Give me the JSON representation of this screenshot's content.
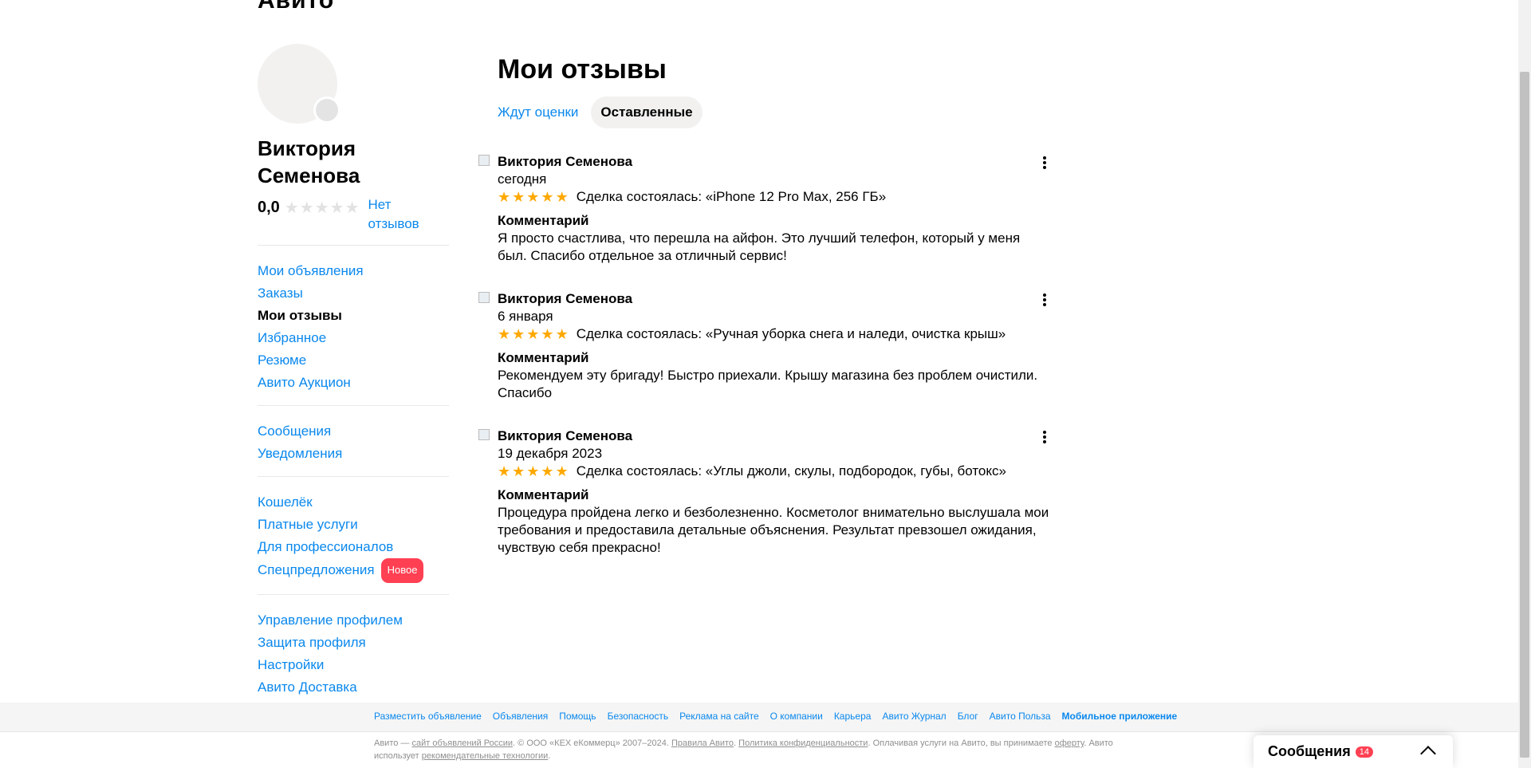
{
  "header": {
    "logo": "Авито",
    "breadcrumb": "Мои отзывы"
  },
  "profile": {
    "name": "Виктория Семенова",
    "rating": "0,0",
    "no_reviews": "Нет отзывов"
  },
  "sidebar": {
    "group1": [
      "Мои объявления",
      "Заказы",
      "Мои отзывы",
      "Избранное",
      "Резюме",
      "Авито Аукцион"
    ],
    "group2": [
      "Сообщения",
      "Уведомления"
    ],
    "group3": [
      "Кошелёк",
      "Платные услуги",
      "Для профессионалов",
      "Спецпредложения"
    ],
    "badge_new": "Новое",
    "group4": [
      "Управление профилем",
      "Защита профиля",
      "Настройки",
      "Авито Доставка"
    ]
  },
  "main": {
    "title": "Мои отзывы",
    "tabs": [
      "Ждут оценки",
      "Оставленные"
    ],
    "comment_label": "Комментарий",
    "reviews": [
      {
        "author": "Виктория Семенова",
        "date": "сегодня",
        "deal": "Сделка состоялась: «iPhone 12 Pro Max, 256 ГБ»",
        "comment": "Я просто счастлива, что перешла на айфон. Это лучший телефон, который у меня был. Спасибо отдельное за отличный сервис!"
      },
      {
        "author": "Виктория Семенова",
        "date": "6 января",
        "deal": "Сделка состоялась: «Ручная уборка снега и наледи, очистка крыш»",
        "comment": "Рекомендуем эту бригаду! Быстро приехали. Крышу магазина без проблем очистили. Спасибо"
      },
      {
        "author": "Виктория Семенова",
        "date": "19 декабря 2023",
        "deal": "Сделка состоялась: «Углы джоли, скулы, подбородок, губы, ботокс»",
        "comment": "Процедура пройдена легко и безболезненно. Косметолог внимательно выслушала мои требования и предоставила детальные объяснения. Результат превзошел ожидания, чувствую себя прекрасно!"
      }
    ]
  },
  "footer": {
    "links": [
      "Разместить объявление",
      "Объявления",
      "Помощь",
      "Безопасность",
      "Реклама на сайте",
      "О компании",
      "Карьера",
      "Авито Журнал",
      "Блог",
      "Авито Польза",
      "Мобильное приложение"
    ],
    "legal_prefix": "Авито — ",
    "legal_link1": "сайт объявлений России",
    "legal_mid1": ". © ООО «КЕХ еКоммерц» 2007–2024. ",
    "legal_link2": "Правила Авито",
    "legal_mid2": ". ",
    "legal_link3": "Политика конфиденциальности",
    "legal_mid3": ". Оплачивая услуги на Авито, вы принимаете ",
    "legal_link4": "оферту",
    "legal_mid4": ". Авито использует ",
    "legal_link5": "рекомендательные технологии",
    "legal_end": "."
  },
  "messages_widget": {
    "title": "Сообщения",
    "count": "14"
  },
  "colors": {
    "link": "#0a88ed",
    "star": "#ffa900",
    "badge": "#ff4053"
  }
}
